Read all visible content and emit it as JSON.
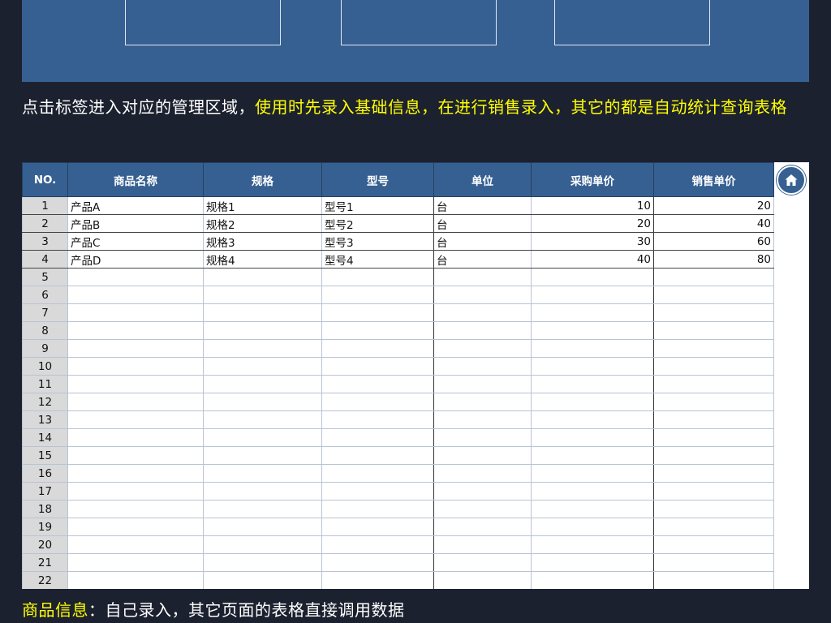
{
  "instruction": {
    "part1": "点击标签进入对应的管理区域，",
    "part2": "使用时先录入基础信息，在进行销售录入，其它的都是自动统计查询表格"
  },
  "table": {
    "headers": [
      "NO.",
      "商品名称",
      "规格",
      "型号",
      "单位",
      "采购单价",
      "销售单价"
    ],
    "rows": [
      {
        "no": "1",
        "name": "产品A",
        "spec": "规格1",
        "model": "型号1",
        "unit": "台",
        "purchase": "10",
        "sale": "20"
      },
      {
        "no": "2",
        "name": "产品B",
        "spec": "规格2",
        "model": "型号2",
        "unit": "台",
        "purchase": "20",
        "sale": "40"
      },
      {
        "no": "3",
        "name": "产品C",
        "spec": "规格3",
        "model": "型号3",
        "unit": "台",
        "purchase": "30",
        "sale": "60"
      },
      {
        "no": "4",
        "name": "产品D",
        "spec": "规格4",
        "model": "型号4",
        "unit": "台",
        "purchase": "40",
        "sale": "80"
      },
      {
        "no": "5"
      },
      {
        "no": "6"
      },
      {
        "no": "7"
      },
      {
        "no": "8"
      },
      {
        "no": "9"
      },
      {
        "no": "10"
      },
      {
        "no": "11"
      },
      {
        "no": "12"
      },
      {
        "no": "13"
      },
      {
        "no": "14"
      },
      {
        "no": "15"
      },
      {
        "no": "16"
      },
      {
        "no": "17"
      },
      {
        "no": "18"
      },
      {
        "no": "19"
      },
      {
        "no": "20"
      },
      {
        "no": "21"
      },
      {
        "no": "22"
      }
    ]
  },
  "home_button": {
    "icon": "home-icon"
  },
  "footer": {
    "label": "商品信息",
    "colon": "：",
    "text": "自己录入，其它页面的表格直接调用数据"
  },
  "colors": {
    "background": "#1c2130",
    "header_blue": "#366092",
    "highlight": "#ffff00",
    "row_number_bg": "#d9d9d9"
  }
}
